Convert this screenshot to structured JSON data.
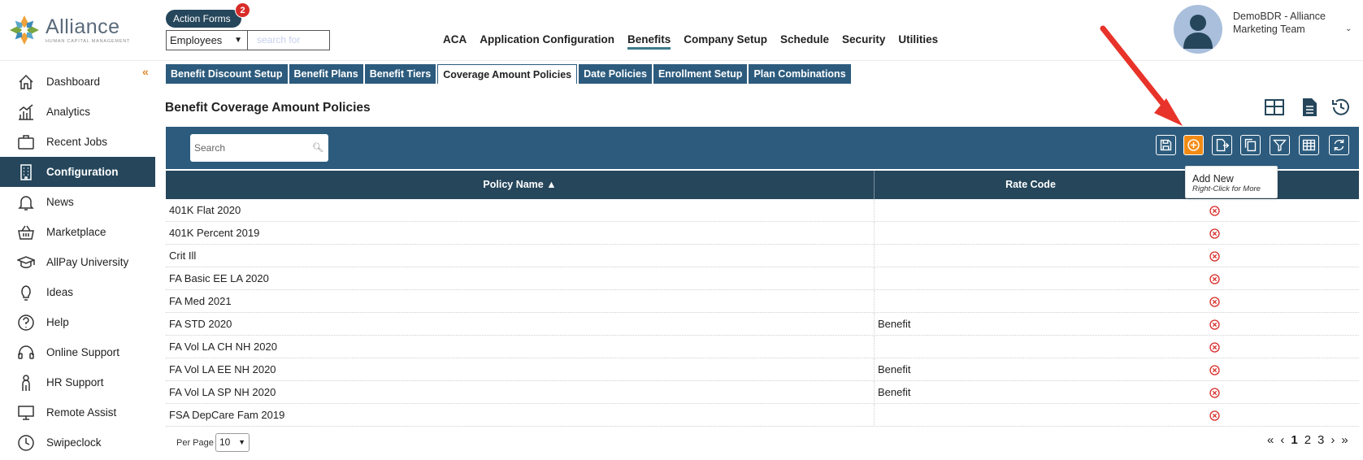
{
  "logo": {
    "name": "Alliance",
    "tagline": "HUMAN CAPITAL MANAGEMENT"
  },
  "header": {
    "action_forms": "Action Forms",
    "action_forms_badge": "2",
    "employee_select": "Employees",
    "search_placeholder": "search for",
    "nav": [
      "ACA",
      "Application Configuration",
      "Benefits",
      "Company Setup",
      "Schedule",
      "Security",
      "Utilities"
    ],
    "active_nav": "Benefits",
    "user_line1": "DemoBDR - Alliance",
    "user_line2": "Marketing Team"
  },
  "sidebar": {
    "items": [
      {
        "label": "Dashboard",
        "icon": "home-icon"
      },
      {
        "label": "Analytics",
        "icon": "analytics-icon"
      },
      {
        "label": "Recent Jobs",
        "icon": "briefcase-icon"
      },
      {
        "label": "Configuration",
        "icon": "building-icon",
        "active": true
      },
      {
        "label": "News",
        "icon": "bell-icon"
      },
      {
        "label": "Marketplace",
        "icon": "basket-icon"
      },
      {
        "label": "AllPay University",
        "icon": "graduation-cap-icon"
      },
      {
        "label": "Ideas",
        "icon": "lightbulb-icon"
      },
      {
        "label": "Help",
        "icon": "question-icon"
      },
      {
        "label": "Online Support",
        "icon": "headset-icon"
      },
      {
        "label": "HR Support",
        "icon": "person-icon"
      },
      {
        "label": "Remote Assist",
        "icon": "monitor-icon"
      },
      {
        "label": "Swipeclock",
        "icon": "clock-icon"
      }
    ]
  },
  "subtabs": [
    "Benefit Discount Setup",
    "Benefit Plans",
    "Benefit Tiers",
    "Coverage Amount Policies",
    "Date Policies",
    "Enrollment Setup",
    "Plan Combinations"
  ],
  "active_subtab": "Coverage Amount Policies",
  "page_title": "Benefit Coverage Amount Policies",
  "toolbar": {
    "search_placeholder": "Search"
  },
  "tooltip": {
    "title": "Add New",
    "hint": "Right-Click for More"
  },
  "table": {
    "columns": [
      "Policy Name ▲",
      "Rate Code"
    ],
    "rows": [
      {
        "name": "401K Flat 2020",
        "rate": ""
      },
      {
        "name": "401K Percent 2019",
        "rate": ""
      },
      {
        "name": "Crit Ill",
        "rate": ""
      },
      {
        "name": "FA Basic EE LA 2020",
        "rate": ""
      },
      {
        "name": "FA Med 2021",
        "rate": ""
      },
      {
        "name": "FA STD 2020",
        "rate": "Benefit"
      },
      {
        "name": "FA Vol LA CH NH 2020",
        "rate": ""
      },
      {
        "name": "FA Vol LA EE NH 2020",
        "rate": "Benefit"
      },
      {
        "name": "FA Vol LA SP NH 2020",
        "rate": "Benefit"
      },
      {
        "name": "FSA DepCare Fam 2019",
        "rate": ""
      }
    ]
  },
  "footer": {
    "per_page_label": "Per Page",
    "per_page_value": "10",
    "pages": [
      "1",
      "2",
      "3"
    ],
    "current_page": "1"
  },
  "colors": {
    "navy": "#25465b",
    "toolbar_blue": "#2c5b7d",
    "accent_orange": "#f28b14",
    "delete_red": "#d82c28"
  }
}
